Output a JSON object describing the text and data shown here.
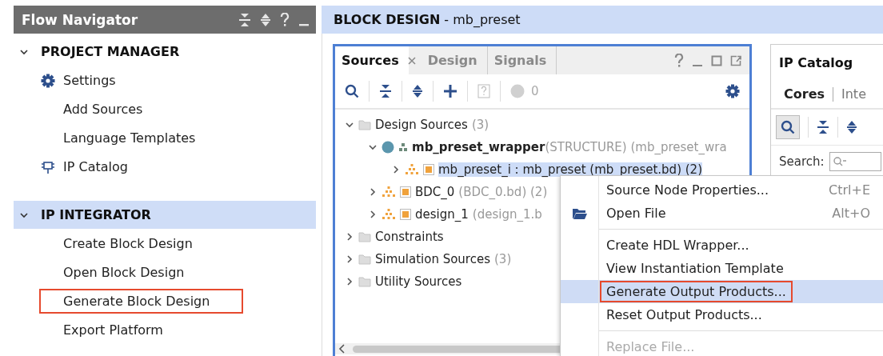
{
  "flow_navigator": {
    "title": "Flow Navigator",
    "sections": [
      {
        "title": "PROJECT MANAGER",
        "expanded": true,
        "selected": false,
        "items": [
          {
            "label": "Settings",
            "kind": "gear",
            "highlighted": false
          },
          {
            "label": "Add Sources",
            "kind": "plain",
            "highlighted": false
          },
          {
            "label": "Language Templates",
            "kind": "plain",
            "highlighted": false
          },
          {
            "label": "IP Catalog",
            "kind": "chip",
            "highlighted": false
          }
        ]
      },
      {
        "title": "IP INTEGRATOR",
        "expanded": true,
        "selected": true,
        "items": [
          {
            "label": "Create Block Design",
            "kind": "plain",
            "highlighted": false
          },
          {
            "label": "Open Block Design",
            "kind": "plain",
            "highlighted": false
          },
          {
            "label": "Generate Block Design",
            "kind": "plain",
            "highlighted": true
          },
          {
            "label": "Export Platform",
            "kind": "plain",
            "highlighted": false
          }
        ]
      }
    ]
  },
  "block_design": {
    "title": "BLOCK DESIGN",
    "subtitle": "- mb_preset"
  },
  "sources_panel": {
    "tabs": [
      {
        "label": "Sources",
        "selected": true
      },
      {
        "label": "Design",
        "selected": false
      },
      {
        "label": "Signals",
        "selected": false
      }
    ],
    "count": "0",
    "tree": [
      {
        "kind": "folder",
        "name": "Design Sources",
        "detail": "(3)",
        "expanded": true,
        "selected": false,
        "children": [
          {
            "kind": "wrapper",
            "name": "mb_preset_wrapper",
            "detail": "(STRUCTURE) (mb_preset_wra",
            "expanded": true,
            "selected": false,
            "children": [
              {
                "kind": "block",
                "name": "mb_preset_i : mb_preset (mb_preset.bd) (2)",
                "expanded": false,
                "selected": true
              }
            ]
          },
          {
            "kind": "block",
            "name": "BDC_0",
            "detail": "(BDC_0.bd) (2)",
            "expanded": false,
            "selected": false
          },
          {
            "kind": "block",
            "name": "design_1",
            "detail": "(design_1.b",
            "expanded": false,
            "selected": false
          }
        ]
      },
      {
        "kind": "folder",
        "name": "Constraints",
        "expanded": false,
        "selected": false
      },
      {
        "kind": "folder",
        "name": "Simulation Sources",
        "detail": "(3)",
        "expanded": false,
        "selected": false
      },
      {
        "kind": "folder",
        "name": "Utility Sources",
        "expanded": false,
        "selected": false
      }
    ]
  },
  "ip_catalog": {
    "title": "IP Catalog",
    "tabs": [
      {
        "label": "Cores",
        "selected": true
      },
      {
        "label": "Inte",
        "selected": false
      }
    ],
    "search_label": "Search:"
  },
  "context_menu": {
    "items": [
      {
        "kind": "item",
        "label": "Source Node Properties...",
        "shortcut": "Ctrl+E",
        "icon": false,
        "selected": false,
        "disabled": false,
        "highlighted": false
      },
      {
        "kind": "item",
        "label": "Open File",
        "shortcut": "Alt+O",
        "icon": true,
        "selected": false,
        "disabled": false,
        "highlighted": false
      },
      {
        "kind": "separator"
      },
      {
        "kind": "item",
        "label": "Create HDL Wrapper...",
        "icon": false,
        "selected": false,
        "disabled": false,
        "highlighted": false
      },
      {
        "kind": "item",
        "label": "View Instantiation Template",
        "icon": false,
        "selected": false,
        "disabled": false,
        "highlighted": false
      },
      {
        "kind": "item",
        "label": "Generate Output Products...",
        "icon": false,
        "selected": true,
        "disabled": false,
        "highlighted": true
      },
      {
        "kind": "item",
        "label": "Reset Output Products...",
        "icon": false,
        "selected": false,
        "disabled": false,
        "highlighted": false
      },
      {
        "kind": "separator"
      },
      {
        "kind": "item",
        "label": "Replace File...",
        "icon": false,
        "selected": false,
        "disabled": true,
        "highlighted": false
      }
    ]
  }
}
